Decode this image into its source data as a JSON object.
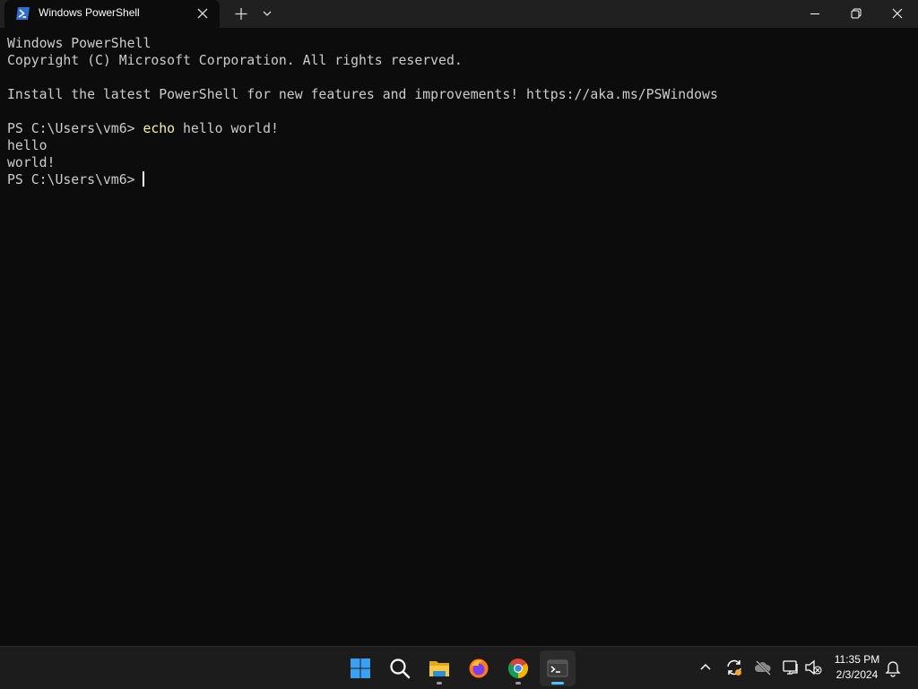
{
  "window": {
    "tab_title": "Windows PowerShell",
    "tab_icon": "powershell-icon"
  },
  "terminal": {
    "line1": "Windows PowerShell",
    "line2": "Copyright (C) Microsoft Corporation. All rights reserved.",
    "line3": "Install the latest PowerShell for new features and improvements! https://aka.ms/PSWindows",
    "prompt1": "PS C:\\Users\\vm6> ",
    "command": "echo",
    "command_args": " hello world!",
    "output1": "hello",
    "output2": "world!",
    "prompt2": "PS C:\\Users\\vm6> "
  },
  "taskbar": {
    "apps": [
      "windows-start-icon",
      "search-icon",
      "file-explorer-icon",
      "firefox-icon",
      "chrome-icon",
      "terminal-icon"
    ],
    "time": "11:35 PM",
    "date": "2/3/2024"
  },
  "colors": {
    "terminal_bg": "#0c0c0c",
    "terminal_text": "#cccccc",
    "command_color": "#f9f1a5",
    "titlebar_bg": "#202020",
    "taskbar_bg": "#1c1c1c",
    "accent": "#4cc2ff"
  }
}
